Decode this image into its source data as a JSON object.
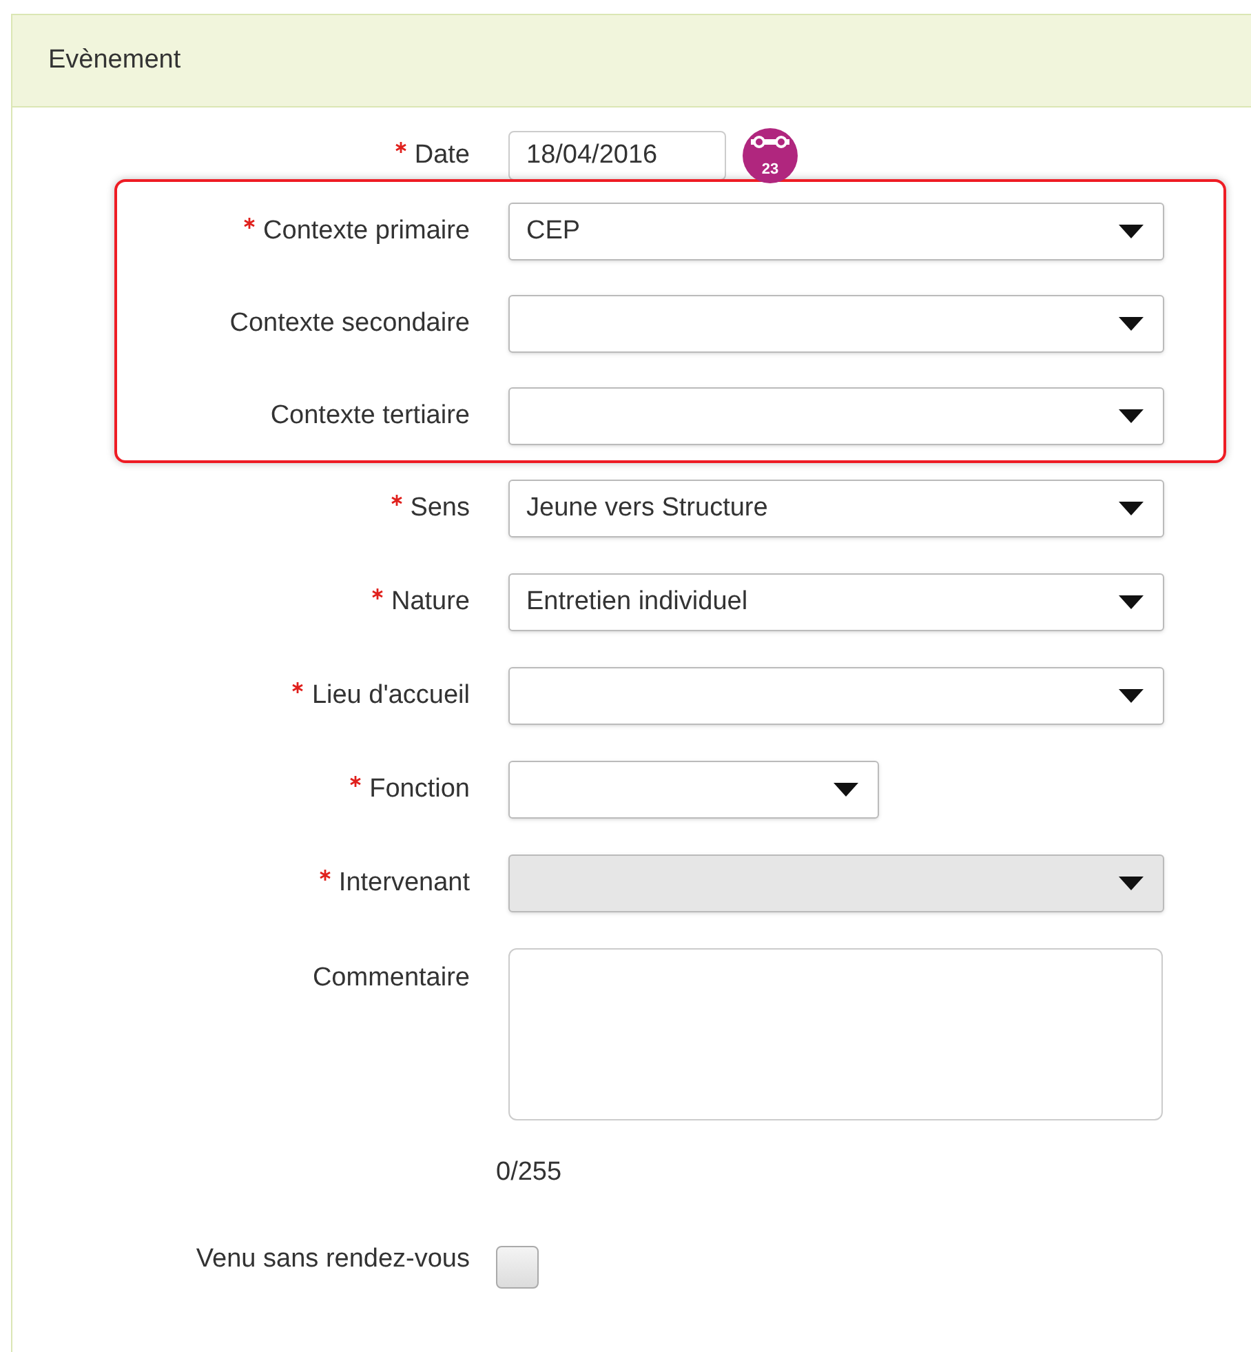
{
  "panel": {
    "title": "Evènement"
  },
  "groups": [
    {
      "highlighted": false,
      "fields": [
        {
          "kind": "date",
          "label": "Date",
          "required": true,
          "value": "18/04/2016",
          "calendar_day": "23"
        }
      ]
    },
    {
      "highlighted": true,
      "fields": [
        {
          "kind": "select",
          "label": "Contexte primaire",
          "required": true,
          "value": "CEP",
          "disabled": false
        },
        {
          "kind": "select",
          "label": "Contexte secondaire",
          "required": false,
          "disabled": false
        },
        {
          "kind": "select",
          "label": "Contexte tertiaire",
          "required": false,
          "disabled": false
        }
      ]
    },
    {
      "highlighted": false,
      "fields": [
        {
          "kind": "select",
          "label": "Sens",
          "required": true,
          "value": "Jeune vers Structure",
          "disabled": false
        },
        {
          "kind": "select",
          "label": "Nature",
          "required": true,
          "value": "Entretien individuel",
          "disabled": false
        },
        {
          "kind": "select",
          "label": "Lieu d'accueil",
          "required": true,
          "disabled": false
        },
        {
          "kind": "short-select",
          "label": "Fonction",
          "required": true,
          "disabled": false
        },
        {
          "kind": "select",
          "label": "Intervenant",
          "required": true,
          "disabled": true
        },
        {
          "kind": "textarea",
          "label": "Commentaire",
          "required": false,
          "counter": "0/255"
        },
        {
          "kind": "checkbox",
          "label": "Venu sans rendez-vous",
          "required": false,
          "checked": false
        }
      ]
    }
  ]
}
